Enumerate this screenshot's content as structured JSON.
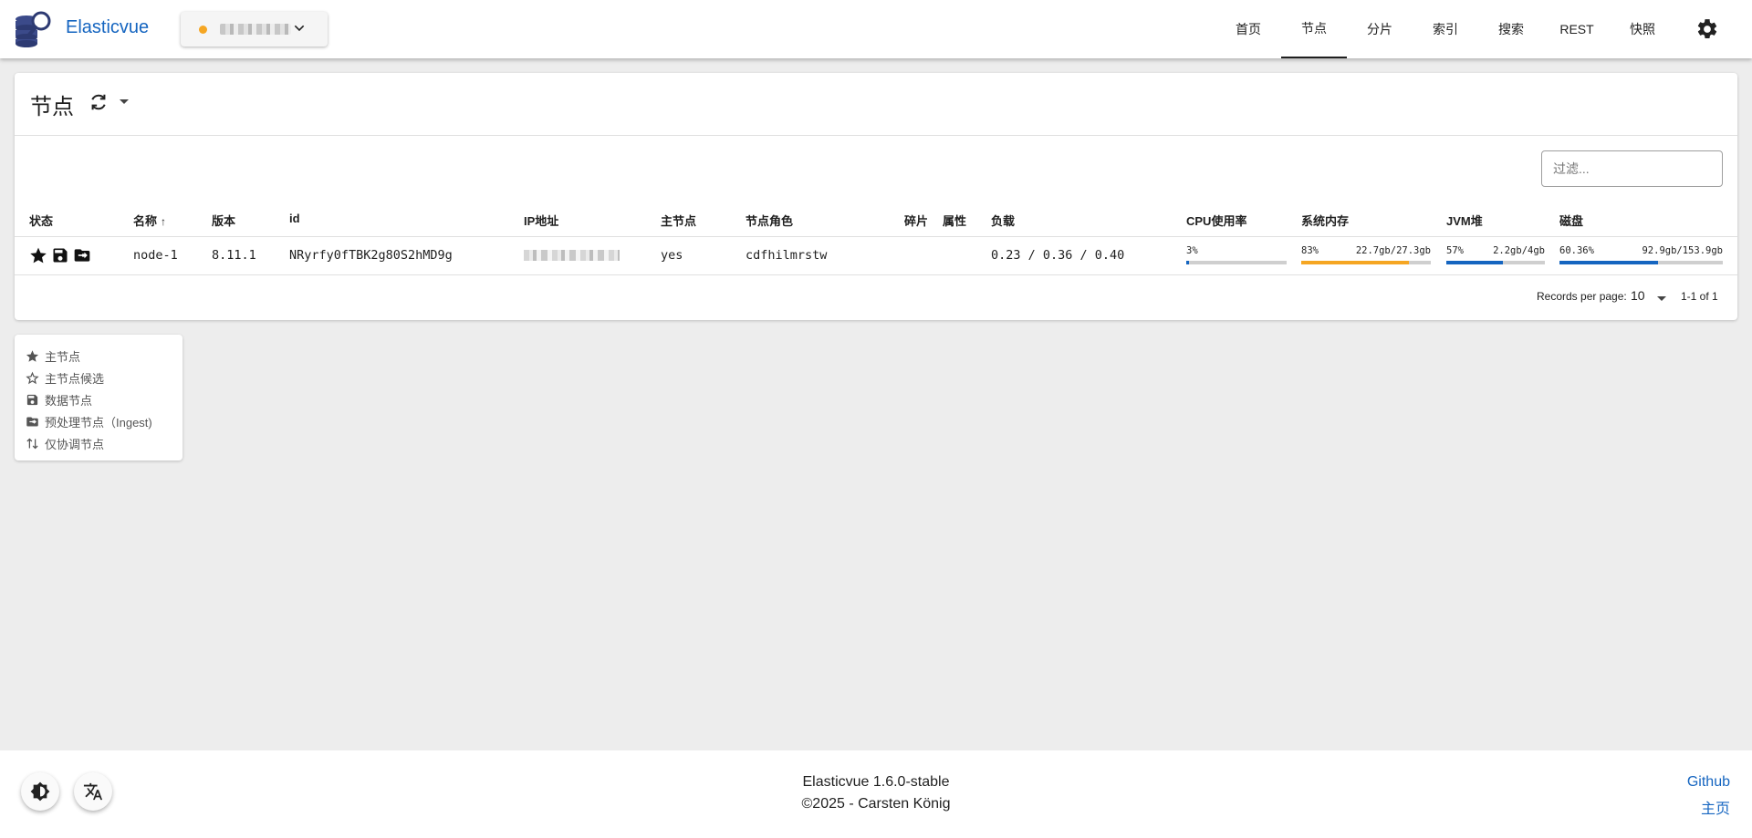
{
  "app": {
    "name": "Elasticvue"
  },
  "cluster_selector": {
    "status_color": "#f5a623"
  },
  "nav": {
    "items": [
      "首页",
      "节点",
      "分片",
      "索引",
      "搜索",
      "REST",
      "快照"
    ],
    "active": "节点"
  },
  "nodes": {
    "title": "节点",
    "filter": {
      "placeholder": "过滤...",
      "value": ""
    },
    "columns": {
      "status": "状态",
      "name": "名称",
      "version": "版本",
      "id": "id",
      "ip": "IP地址",
      "master": "主节点",
      "roles": "节点角色",
      "shards": "碎片",
      "attributes": "属性",
      "load": "负载",
      "cpu": "CPU使用率",
      "ram": "系统内存",
      "heap": "JVM堆",
      "disk": "磁盘"
    },
    "sort": {
      "column": "name",
      "direction": "asc"
    },
    "rows": [
      {
        "status_icons": [
          "master-star-icon",
          "data-node-icon",
          "ingest-node-icon"
        ],
        "name": "node-1",
        "version": "8.11.1",
        "id": "NRyrfy0fTBK2g80S2hMD9g",
        "master": "yes",
        "roles": "cdfhilmrstw",
        "load": "0.23 / 0.36 / 0.40",
        "cpu": {
          "label": "3%",
          "percent": 3
        },
        "ram": {
          "percent_label": "83%",
          "usage": "22.7gb/27.3gb",
          "percent": 83
        },
        "heap": {
          "percent_label": "57%",
          "usage": "2.2gb/4gb",
          "percent": 57
        },
        "disk": {
          "percent_label": "60.36%",
          "usage": "92.9gb/153.9gb",
          "percent": 60.36
        }
      }
    ],
    "pagination": {
      "records_per_page_label": "Records per page:",
      "records_per_page": "10",
      "range": "1-1 of 1"
    }
  },
  "legend": {
    "items": [
      {
        "icon": "star-filled-icon",
        "label": "主节点"
      },
      {
        "icon": "star-outline-icon",
        "label": "主节点候选"
      },
      {
        "icon": "save-icon",
        "label": "数据节点"
      },
      {
        "icon": "folder-arrow-icon",
        "label": "预处理节点（Ingest)"
      },
      {
        "icon": "swap-arrows-icon",
        "label": "仅协调节点"
      }
    ]
  },
  "footer": {
    "version": "Elasticvue 1.6.0-stable",
    "copyright": "©2025 - Carsten König",
    "links": [
      "Github",
      "主页"
    ]
  },
  "colors": {
    "accent": "#1565c0",
    "cpu_bar": "#1565c0",
    "ram_bar": "#f5a623",
    "heap_bar": "#1565c0",
    "disk_bar": "#1565c0"
  }
}
